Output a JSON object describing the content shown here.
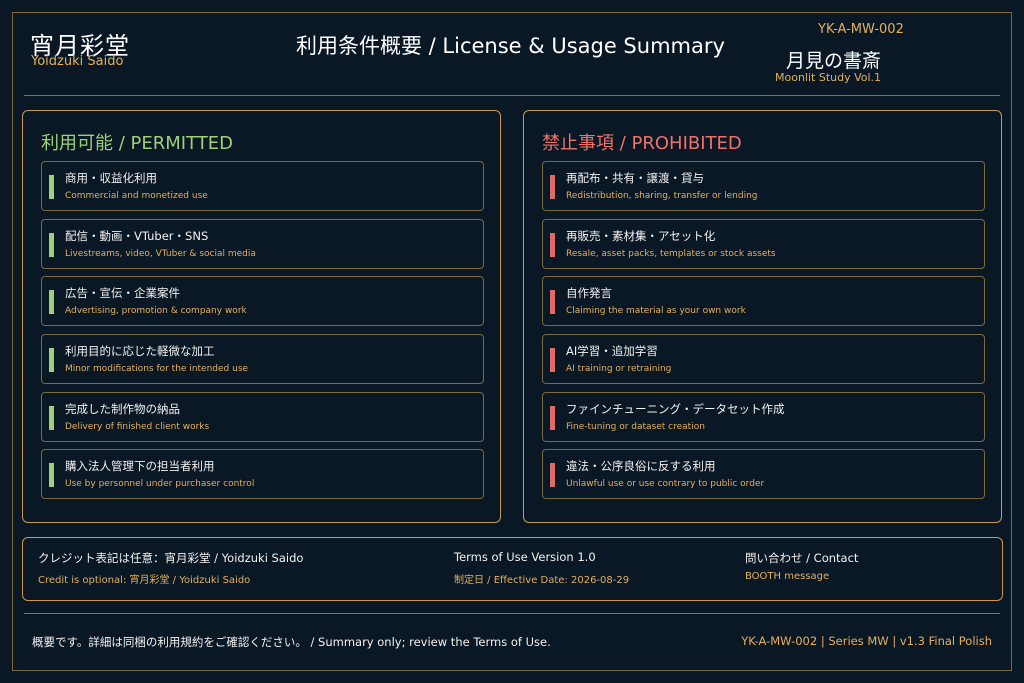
{
  "header": {
    "brand_jp": "宵月彩堂",
    "brand_en": "Yoidzuki Saido",
    "title": "利用条件概要 / License & Usage Summary",
    "doc_code": "YK-A-MW-002",
    "book_jp": "月見の書斎",
    "book_en": "Moonlit Study Vol.1"
  },
  "permitted": {
    "title": "利用可能 / PERMITTED",
    "items": [
      {
        "jp": "商用・収益化利用",
        "en": "Commercial and monetized use"
      },
      {
        "jp": "配信・動画・VTuber・SNS",
        "en": "Livestreams, video, VTuber & social media"
      },
      {
        "jp": "広告・宣伝・企業案件",
        "en": "Advertising, promotion & company work"
      },
      {
        "jp": "利用目的に応じた軽微な加工",
        "en": "Minor modifications for the intended use"
      },
      {
        "jp": "完成した制作物の納品",
        "en": "Delivery of finished client works"
      },
      {
        "jp": "購入法人管理下の担当者利用",
        "en": "Use by personnel under purchaser control"
      }
    ]
  },
  "prohibited": {
    "title": "禁止事項 / PROHIBITED",
    "items": [
      {
        "jp": "再配布・共有・譲渡・貸与",
        "en": "Redistribution, sharing, transfer or lending"
      },
      {
        "jp": "再販売・素材集・アセット化",
        "en": "Resale, asset packs, templates or stock assets"
      },
      {
        "jp": "自作発言",
        "en": "Claiming the material as your own work"
      },
      {
        "jp": "AI学習・追加学習",
        "en": "AI training or retraining"
      },
      {
        "jp": "ファインチューニング・データセット作成",
        "en": "Fine-tuning or dataset creation"
      },
      {
        "jp": "違法・公序良俗に反する利用",
        "en": "Unlawful use or use contrary to public order"
      }
    ]
  },
  "info": {
    "credit_jp": "クレジット表記は任意：宵月彩堂 / Yoidzuki Saido",
    "credit_en": "Credit is optional: 宵月彩堂 / Yoidzuki Saido",
    "terms": "Terms of Use Version 1.0",
    "date": "制定日 / Effective Date: 2026-08-29",
    "contact": "問い合わせ / Contact",
    "contact_via": "BOOTH message"
  },
  "footer": {
    "note": "概要です。詳細は同梱の利用規約をご確認ください。 / Summary only; review the Terms of Use.",
    "meta": "YK-A-MW-002  |  Series MW  |  v1.3 Final Polish"
  },
  "colors": {
    "background": "#0a1724",
    "gold": "#e3b15c",
    "permitted": "#9ed07a",
    "prohibited": "#f0716a"
  }
}
